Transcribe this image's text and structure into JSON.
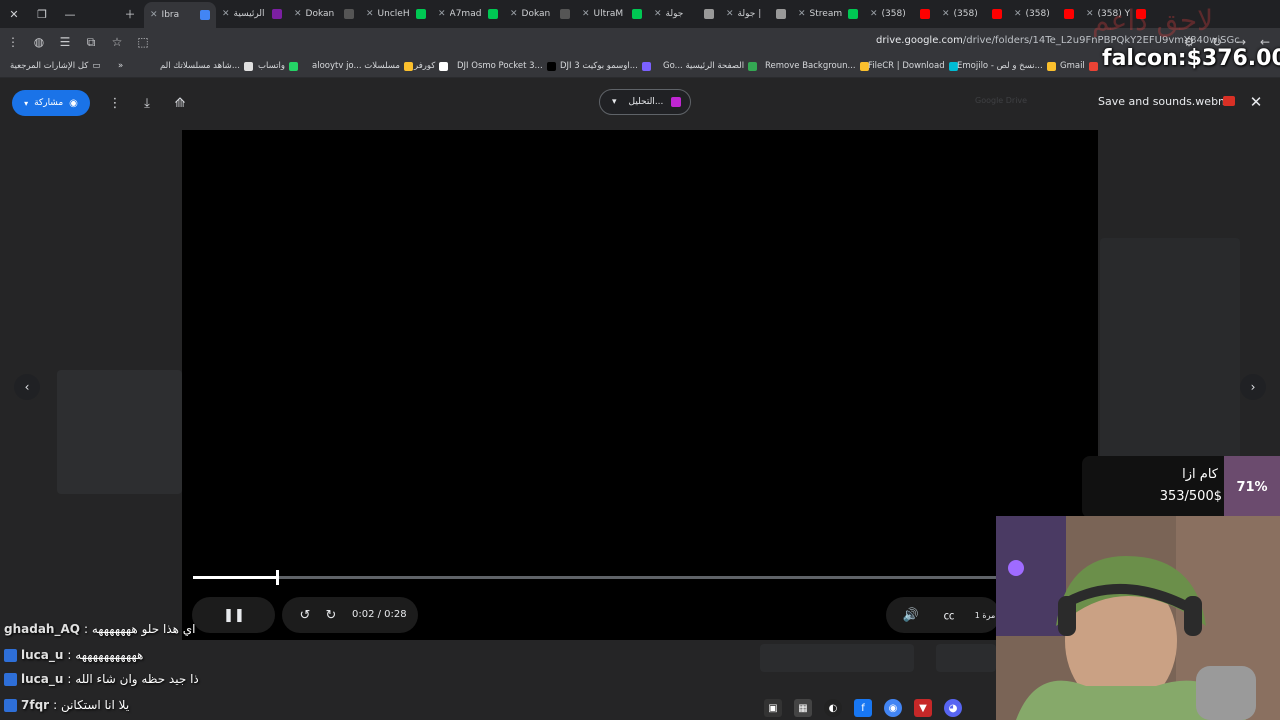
{
  "tabs": [
    {
      "label": "Ibra",
      "active": true,
      "color": "#4285f4"
    },
    {
      "label": "الرئيسية",
      "color": "#7b1fa2"
    },
    {
      "label": "Dokan",
      "color": "#555555"
    },
    {
      "label": "UncleH",
      "color": "#00c853"
    },
    {
      "label": "A7mad",
      "color": "#00c853"
    },
    {
      "label": "Dokan",
      "color": "#555555"
    },
    {
      "label": "UltraM",
      "color": "#00c853"
    },
    {
      "label": "جولة",
      "color": "#999999"
    },
    {
      "label": "جولة |",
      "color": "#999999"
    },
    {
      "label": "Stream",
      "color": "#00c853"
    },
    {
      "label": "(358)",
      "color": "#ff0000"
    },
    {
      "label": "(358)",
      "color": "#ff0000"
    },
    {
      "label": "(358)",
      "color": "#ff0000"
    },
    {
      "label": "(358) Y",
      "color": "#ff0000"
    }
  ],
  "toolbar": {
    "url_domain": "drive.google.com",
    "url_path": "/drive/folders/14Te_L2u9FnPBPQkY2EFU9vmY840wiSGc"
  },
  "bookmarks": [
    {
      "label": "كل الإشارات المرجعية",
      "color": "#9aa0a6"
    },
    {
      "label": "شاهد مسلسلاتك الم...",
      "color": "#e0e0e0"
    },
    {
      "label": "واتساب",
      "color": "#25d366"
    },
    {
      "label": "alooytv jo... مسلسلات",
      "color": "#fbc02d"
    },
    {
      "label": "كورفر",
      "color": "#ffffff"
    },
    {
      "label": "DJI Osmo Pocket 3...",
      "color": "#000000"
    },
    {
      "label": "DJI اوسمو بوكيت 3...",
      "color": "#7b61ff"
    },
    {
      "label": "Go... الصفحة الرئيسية",
      "color": "#34a853"
    },
    {
      "label": "Remove Backgroun...",
      "color": "#fbc02d"
    },
    {
      "label": "FileCR | Download",
      "color": "#00bcd4"
    },
    {
      "label": "Emojilo - نسخ و لص...",
      "color": "#fbc02d"
    },
    {
      "label": "Gmail",
      "color": "#ea4335"
    }
  ],
  "viewer": {
    "share_label": "مشاركة",
    "open_with_label": "التحليل...",
    "file_title": "Save and sounds.webm",
    "drive_hint": "Google Drive"
  },
  "player": {
    "time": "0:02 / 0:28",
    "progress": 0.105,
    "speed_label": "1 مرة"
  },
  "overlays": {
    "donation": "falcon:$376.00",
    "goal_name": "كام ازا",
    "goal_count": "353/500$",
    "goal_percent": "71%",
    "watermark": "لاحق داعم"
  },
  "chat": [
    {
      "user": "ghadah_AQ",
      "message": ": اي هذا حلو هههههههه"
    },
    {
      "user": "luca_u",
      "message": ": هههههههههههه"
    },
    {
      "user": "luca_u",
      "message": ": ذا جيد حظه وان شاء الله"
    },
    {
      "user": "7fqr",
      "message": ": يلا انا استكانن"
    }
  ],
  "colors": {
    "accent": "#1a73e8",
    "goal_fill": "#6b4b6e",
    "page_bg": "#1f1f1f"
  }
}
